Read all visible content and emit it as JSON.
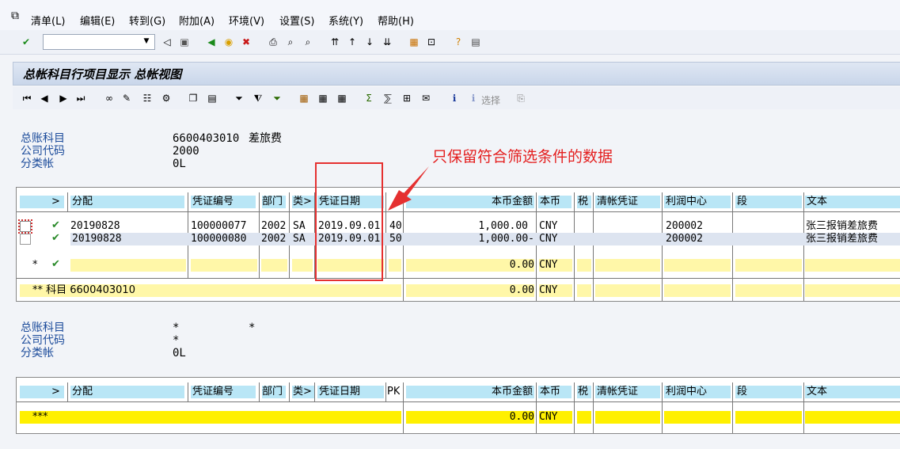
{
  "menu": [
    "清单(L)",
    "编辑(E)",
    "转到(G)",
    "附加(A)",
    "环境(V)",
    "设置(S)",
    "系统(Y)",
    "帮助(H)"
  ],
  "command_field": {
    "value": ""
  },
  "title": "总帐科目行项目显示 总帐视图",
  "app_toolbar": {
    "select_label": "选择"
  },
  "header1": {
    "labels": [
      "总账科目",
      "公司代码",
      "分类帐"
    ],
    "account": "6600403010",
    "account_name": "差旅费",
    "company": "2000",
    "ledger": "0L"
  },
  "columns": [
    ">",
    "分配",
    "凭证编号",
    "部门",
    "类>",
    "凭证日期",
    "PK",
    "本币金额",
    "本币",
    "税",
    "清帐凭证",
    "利润中心",
    "段",
    "文本"
  ],
  "rows": [
    {
      "assign": "20190828",
      "docno": "100000077",
      "dept": "2002",
      "type": "SA",
      "date": "2019.09.01",
      "pk": "40",
      "amount": "1,000.00",
      "curr": "CNY",
      "profit": "200002",
      "text": "张三报销差旅费"
    },
    {
      "assign": "20190828",
      "docno": "100000080",
      "dept": "2002",
      "type": "SA",
      "date": "2019.09.01",
      "pk": "50",
      "amount": "1,000.00-",
      "curr": "CNY",
      "profit": "200002",
      "text": "张三报销差旅费"
    }
  ],
  "subtotal": {
    "marker": "*",
    "amount": "0.00",
    "curr": "CNY"
  },
  "account_total": {
    "label": "** 科目 6600403010",
    "amount": "0.00",
    "curr": "CNY"
  },
  "header2": {
    "labels": [
      "总账科目",
      "公司代码",
      "分类帐"
    ],
    "account": "*",
    "account_name": "*",
    "company": "*",
    "ledger": "0L"
  },
  "grand_total": {
    "label": "***",
    "amount": "0.00",
    "curr": "CNY"
  },
  "annotation": "只保留符合筛选条件的数据",
  "colors": {
    "header_cyan": "#b9e6f6",
    "subtotal_yellow": "#fff7a8",
    "total_yellow": "#fff000",
    "annotation_red": "#e53030"
  }
}
